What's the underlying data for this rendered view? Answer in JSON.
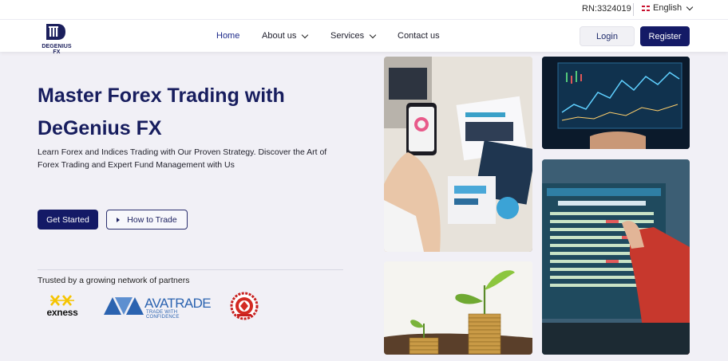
{
  "topbar": {
    "registration": "RN:3324019",
    "language": "English"
  },
  "brand": {
    "name": "DEGENIUS FX"
  },
  "nav": {
    "links": [
      {
        "label": "Home",
        "active": true
      },
      {
        "label": "About us",
        "has_dropdown": true
      },
      {
        "label": "Services",
        "has_dropdown": true
      },
      {
        "label": "Contact us"
      }
    ],
    "login_label": "Login",
    "register_label": "Register"
  },
  "hero": {
    "title_line1": "Master Forex Trading with",
    "title_line2": "DeGenius FX",
    "description": "Learn Forex and Indices Trading with Our Proven Strategy. Discover the Art of Forex Trading and Expert Fund Management with Us",
    "cta_primary": "Get Started",
    "cta_secondary": "How to Trade"
  },
  "partners": {
    "title": "Trusted by a growing network of partners",
    "logos": [
      {
        "name": "exness",
        "icon": "exness-logo"
      },
      {
        "name": "AVATRADE",
        "tagline": "TRADE WITH CONFIDENCE",
        "icon": "avatrade-logo"
      },
      {
        "name": "seal",
        "icon": "certification-seal"
      }
    ]
  },
  "images": [
    {
      "icon": "analytics-phone-photo"
    },
    {
      "icon": "trading-screens-photo"
    },
    {
      "icon": "stock-listing-monitor-photo"
    },
    {
      "icon": "coin-stacks-plants-photo"
    }
  ],
  "colors": {
    "brand_navy": "#141a66",
    "title_navy": "#171d5e",
    "page_bg": "#f1f0f6",
    "ava_blue": "#2b63b0",
    "exness_yellow": "#f5c400"
  }
}
